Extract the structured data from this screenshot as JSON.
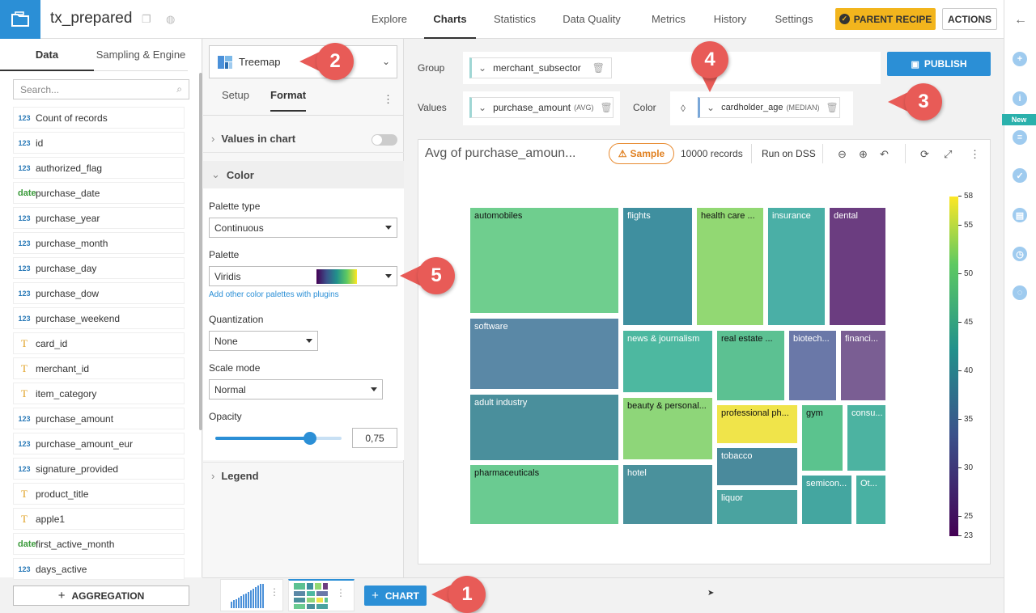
{
  "header": {
    "dataset_name": "tx_prepared",
    "tabs": [
      "Explore",
      "Charts",
      "Statistics",
      "Data Quality",
      "Metrics",
      "History",
      "Settings"
    ],
    "active_tab": "Charts",
    "parent_recipe_label": "PARENT RECIPE",
    "actions_label": "ACTIONS"
  },
  "rail": {
    "new_badge": "New"
  },
  "left_panel": {
    "tabs": [
      "Data",
      "Sampling & Engine"
    ],
    "search_placeholder": "Search...",
    "fields": [
      {
        "type": "123",
        "name": "Count of records"
      },
      {
        "type": "123",
        "name": "id"
      },
      {
        "type": "123",
        "name": "authorized_flag"
      },
      {
        "type": "date",
        "name": "purchase_date"
      },
      {
        "type": "123",
        "name": "purchase_year"
      },
      {
        "type": "123",
        "name": "purchase_month"
      },
      {
        "type": "123",
        "name": "purchase_day"
      },
      {
        "type": "123",
        "name": "purchase_dow"
      },
      {
        "type": "123",
        "name": "purchase_weekend"
      },
      {
        "type": "T",
        "name": "card_id"
      },
      {
        "type": "T",
        "name": "merchant_id"
      },
      {
        "type": "T",
        "name": "item_category"
      },
      {
        "type": "123",
        "name": "purchase_amount"
      },
      {
        "type": "123",
        "name": "purchase_amount_eur"
      },
      {
        "type": "123",
        "name": "signature_provided"
      },
      {
        "type": "T",
        "name": "product_title"
      },
      {
        "type": "T",
        "name": "apple1"
      },
      {
        "type": "date",
        "name": "first_active_month"
      },
      {
        "type": "123",
        "name": "days_active"
      }
    ],
    "aggregation_label": "AGGREGATION"
  },
  "bottom": {
    "chart_button": "CHART"
  },
  "format_panel": {
    "chart_type": "Treemap",
    "tabs": [
      "Setup",
      "Format"
    ],
    "active_tab": "Format",
    "values_in_chart": "Values in chart",
    "color_section": "Color",
    "palette_type_label": "Palette type",
    "palette_type": "Continuous",
    "palette_label": "Palette",
    "palette": "Viridis",
    "add_palettes": "Add other color palettes with plugins",
    "quantization_label": "Quantization",
    "quantization": "None",
    "scale_mode_label": "Scale mode",
    "scale_mode": "Normal",
    "opacity_label": "Opacity",
    "opacity_value": "0,75",
    "opacity": 0.75,
    "legend_section": "Legend"
  },
  "config": {
    "group_label": "Group",
    "group_field": "merchant_subsector",
    "values_label": "Values",
    "values_field": "purchase_amount",
    "values_agg": "(AVG)",
    "color_label": "Color",
    "color_field": "cardholder_age",
    "color_agg": "(MEDIAN)",
    "publish_label": "PUBLISH"
  },
  "chart": {
    "title": "Avg of purchase_amoun...",
    "sample_label": "Sample",
    "records": "10000 records",
    "run_on": "Run on DSS"
  },
  "chart_data": {
    "type": "treemap",
    "title": "Avg of purchase_amoun...",
    "color_scale": {
      "palette": "Viridis",
      "min": 23,
      "max": 58,
      "ticks": [
        58,
        55,
        50,
        45,
        40,
        35,
        30,
        25,
        23
      ]
    },
    "cells": [
      {
        "label": "automobiles",
        "color": "#6fce8e"
      },
      {
        "label": "flights",
        "color": "#3f8f9f"
      },
      {
        "label": "health care ...",
        "color": "#92d873"
      },
      {
        "label": "insurance",
        "color": "#4aafa6"
      },
      {
        "label": "dental",
        "color": "#6b3d80"
      },
      {
        "label": "software",
        "color": "#5a88a6"
      },
      {
        "label": "news & journalism",
        "color": "#4db8a0"
      },
      {
        "label": "real estate ...",
        "color": "#5cc192"
      },
      {
        "label": "biotech...",
        "color": "#6a78a8"
      },
      {
        "label": "financi...",
        "color": "#7a5e93"
      },
      {
        "label": "adult industry",
        "color": "#4a8f9c"
      },
      {
        "label": "beauty & personal...",
        "color": "#8ed679"
      },
      {
        "label": "professional ph...",
        "color": "#f0e44a"
      },
      {
        "label": "gym",
        "color": "#5bc38e"
      },
      {
        "label": "consu...",
        "color": "#4cb3a1"
      },
      {
        "label": "tobacco",
        "color": "#4a8a9c"
      },
      {
        "label": "pharmaceuticals",
        "color": "#6acb91"
      },
      {
        "label": "hotel",
        "color": "#4a919c"
      },
      {
        "label": "liquor",
        "color": "#4aa3a0"
      },
      {
        "label": "semicon...",
        "color": "#44a6a0"
      },
      {
        "label": "Ot...",
        "color": "#49b1a3"
      }
    ]
  },
  "callouts": [
    "1",
    "2",
    "3",
    "4",
    "5"
  ]
}
